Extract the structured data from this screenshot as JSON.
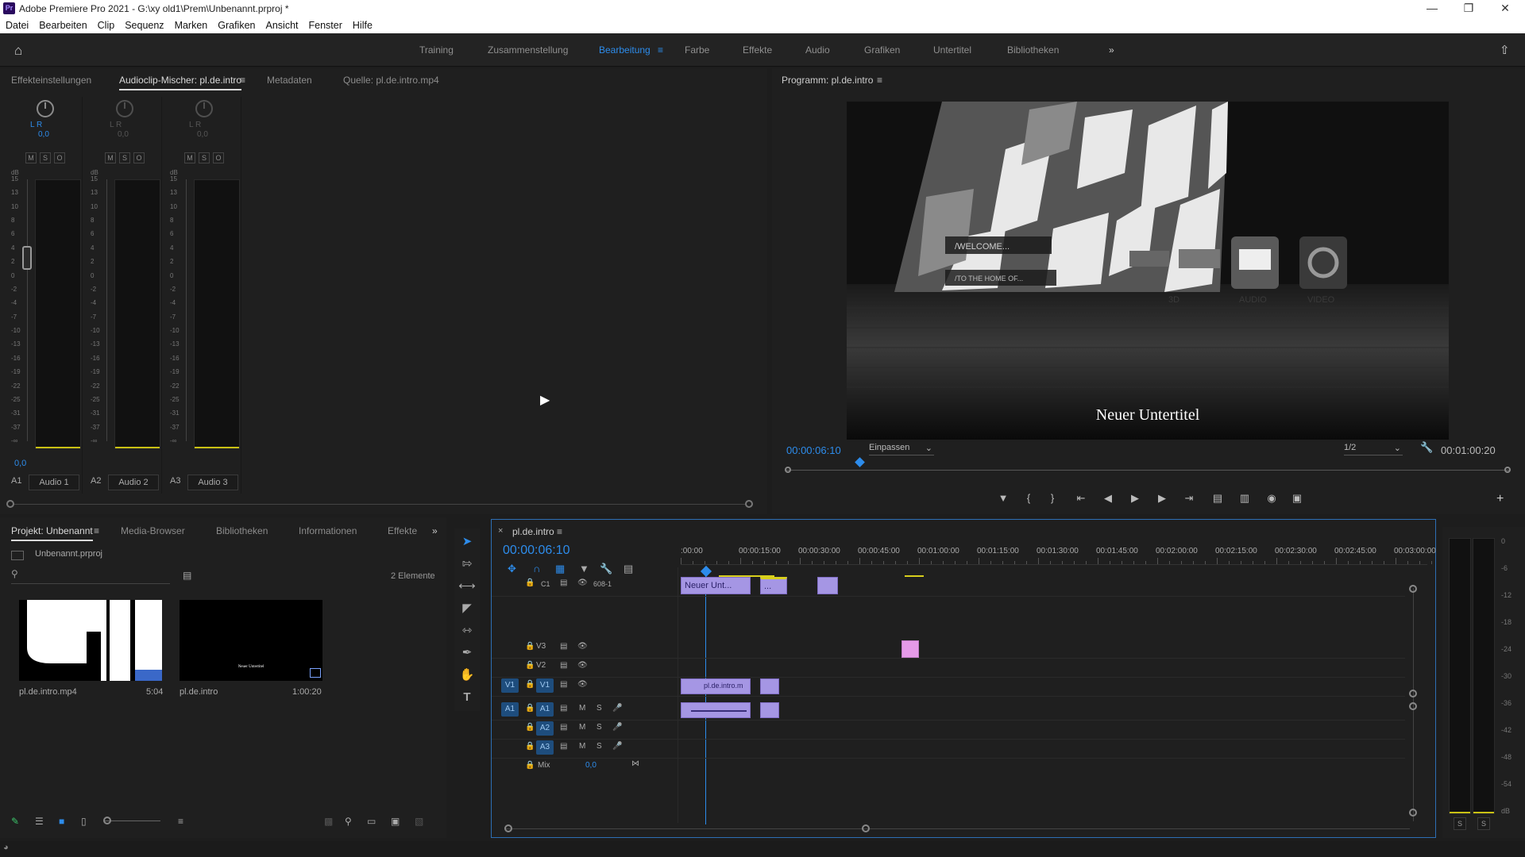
{
  "window": {
    "title": "Adobe Premiere Pro 2021 - G:\\xy old1\\Prem\\Unbenannt.prproj *",
    "app_icon": "Pr"
  },
  "menu": [
    "Datei",
    "Bearbeiten",
    "Clip",
    "Sequenz",
    "Marken",
    "Grafiken",
    "Ansicht",
    "Fenster",
    "Hilfe"
  ],
  "workspaces": [
    "Training",
    "Zusammenstellung",
    "Bearbeitung",
    "Farbe",
    "Effekte",
    "Audio",
    "Grafiken",
    "Untertitel",
    "Bibliotheken"
  ],
  "active_workspace": "Bearbeitung",
  "source_panel": {
    "tabs": [
      "Effekteinstellungen",
      "Audioclip-Mischer: pl.de.intro",
      "Metadaten",
      "Quelle: pl.de.intro.mp4"
    ],
    "active_tab": "Audioclip-Mischer: pl.de.intro",
    "channels": [
      {
        "lr": "L  R",
        "value": "0,0",
        "id": "A1",
        "name": "Audio 1",
        "peak": "0,0"
      },
      {
        "lr": "L  R",
        "value": "0,0",
        "id": "A2",
        "name": "Audio 2",
        "peak": ""
      },
      {
        "lr": "L  R",
        "value": "0,0",
        "id": "A3",
        "name": "Audio 3",
        "peak": ""
      }
    ],
    "msr": [
      "M",
      "S",
      "O"
    ],
    "db_label": "dB",
    "db_scale": [
      "15",
      "13",
      "10",
      "8",
      "6",
      "4",
      "2",
      "0",
      "-2",
      "-4",
      "-7",
      "-10",
      "-13",
      "-16",
      "-19",
      "-22",
      "-25",
      "-31",
      "-37",
      "-∞"
    ]
  },
  "program": {
    "title": "Programm: pl.de.intro",
    "timecode": "00:00:06:10",
    "fit": "Einpassen",
    "resolution": "1/2",
    "duration": "00:01:00:20",
    "subtitle": "Neuer Untertitel",
    "frame_texts": [
      "/WELCOME...",
      "/TO THE HOME OF...",
      "3D",
      "AUDIO",
      "VIDEO"
    ]
  },
  "project": {
    "tabs": [
      "Projekt: Unbenannt",
      "Media-Browser",
      "Bibliotheken",
      "Informationen",
      "Effekte"
    ],
    "active_tab": "Projekt: Unbenannt",
    "file": "Unbenannt.prproj",
    "count": "2 Elemente",
    "items": [
      {
        "name": "pl.de.intro.mp4",
        "duration": "5:04"
      },
      {
        "name": "pl.de.intro",
        "duration": "1:00:20",
        "thumb_caption": "Neuer Untertitel"
      }
    ]
  },
  "timeline": {
    "sequence": "pl.de.intro",
    "timecode": "00:00:06:10",
    "ruler": [
      ":00:00",
      "00:00:15:00",
      "00:00:30:00",
      "00:00:45:00",
      "00:01:00:00",
      "00:01:15:00",
      "00:01:30:00",
      "00:01:45:00",
      "00:02:00:00",
      "00:02:15:00",
      "00:02:30:00",
      "00:02:45:00",
      "00:03:00:00"
    ],
    "caption_track": {
      "id": "C1",
      "name": "608-1",
      "clip": "Neuer Unt...",
      "clip2": "..."
    },
    "video_tracks": [
      "V3",
      "V2",
      "V1"
    ],
    "audio_tracks": [
      "A1",
      "A2",
      "A3"
    ],
    "mix": {
      "label": "Mix",
      "value": "0,0"
    },
    "v1_clip": "pl.de.intro.m",
    "source_patch_v": "V1",
    "source_patch_a": "A1"
  },
  "master_meter": {
    "scale": [
      "0",
      "-6",
      "-12",
      "-18",
      "-24",
      "-30",
      "-36",
      "-42",
      "-48",
      "-54",
      "dB"
    ],
    "solo": [
      "S",
      "S"
    ]
  },
  "colors": {
    "accent": "#2d8ceb",
    "clip": "#a596e4",
    "pink": "#e59ae8",
    "yellow": "#d8cf1c"
  }
}
